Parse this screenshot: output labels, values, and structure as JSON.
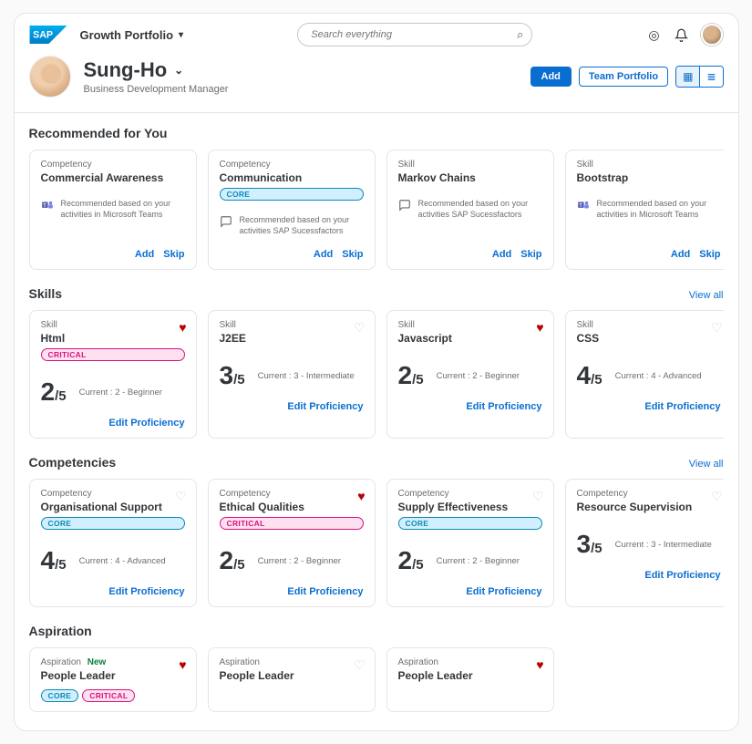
{
  "topbar": {
    "nav_label": "Growth Portfolio",
    "search_placeholder": "Search everything"
  },
  "header": {
    "name": "Sung-Ho",
    "role": "Business Development Manager",
    "add_btn": "Add",
    "team_btn": "Team Portfolio"
  },
  "labels": {
    "competency": "Competency",
    "skill": "Skill",
    "aspiration": "Aspiration",
    "add": "Add",
    "skip": "Skip",
    "edit_prof": "Edit Proficiency",
    "view_all": "View all",
    "new": "New"
  },
  "sections": {
    "recommended": "Recommended for You",
    "skills": "Skills",
    "competencies": "Competencies",
    "aspiration": "Aspiration"
  },
  "recommended": [
    {
      "type": "Competency",
      "title": "Commercial Awareness",
      "pill": null,
      "icon": "teams",
      "rec": "Recommended based on your activities in Microsoft Teams"
    },
    {
      "type": "Competency",
      "title": "Communication",
      "pill": "core",
      "icon": "chat",
      "rec": "Recommended based on your activities SAP Sucessfactors"
    },
    {
      "type": "Skill",
      "title": "Markov Chains",
      "pill": null,
      "icon": "chat",
      "rec": "Recommended based on your activities SAP Sucessfactors"
    },
    {
      "type": "Skill",
      "title": "Bootstrap",
      "pill": null,
      "icon": "teams",
      "rec": "Recommended based on your activities in Microsoft Teams"
    }
  ],
  "skills": [
    {
      "title": "Html",
      "pill": "critical",
      "score": "2",
      "denom": "/5",
      "level": "Current : 2 - Beginner",
      "fav": true
    },
    {
      "title": "J2EE",
      "pill": null,
      "score": "3",
      "denom": "/5",
      "level": "Current : 3 - Intermediate",
      "fav": false
    },
    {
      "title": "Javascript",
      "pill": null,
      "score": "2",
      "denom": "/5",
      "level": "Current : 2 - Beginner",
      "fav": true
    },
    {
      "title": "CSS",
      "pill": null,
      "score": "4",
      "denom": "/5",
      "level": "Current : 4 - Advanced",
      "fav": false
    }
  ],
  "competencies": [
    {
      "title": "Organisational Support",
      "pill": "core",
      "score": "4",
      "denom": "/5",
      "level": "Current : 4 - Advanced",
      "fav": false
    },
    {
      "title": "Ethical Qualities",
      "pill": "critical",
      "score": "2",
      "denom": "/5",
      "level": "Current : 2 - Beginner",
      "fav": true
    },
    {
      "title": "Supply Effectiveness",
      "pill": "core",
      "score": "2",
      "denom": "/5",
      "level": "Current : 2 - Beginner",
      "fav": false
    },
    {
      "title": "Resource Supervision",
      "pill": null,
      "score": "3",
      "denom": "/5",
      "level": "Current : 3 - Intermediate",
      "fav": false
    }
  ],
  "aspirations": [
    {
      "title": "People Leader",
      "new": true,
      "pills": [
        "core",
        "critical"
      ],
      "fav": true
    },
    {
      "title": "People Leader",
      "new": false,
      "pills": [],
      "fav": false
    },
    {
      "title": "People Leader",
      "new": false,
      "pills": [],
      "fav": true
    }
  ]
}
